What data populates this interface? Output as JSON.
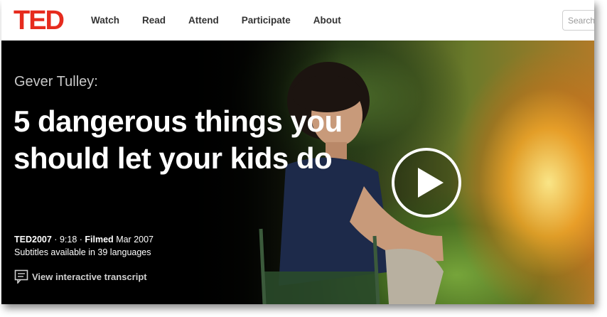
{
  "header": {
    "logo": "TED",
    "nav": [
      "Watch",
      "Read",
      "Attend",
      "Participate",
      "About"
    ],
    "search_placeholder": "Search"
  },
  "talk": {
    "speaker": "Gever Tulley:",
    "title": "5 dangerous things you should let your kids do",
    "event": "TED2007",
    "duration": "9:18",
    "filmed_label": "Filmed",
    "filmed_date": "Mar 2007",
    "subtitles": "Subtitles available in 39 languages",
    "transcript_link": "View interactive transcript"
  },
  "colors": {
    "brand_red": "#e62b1e",
    "hero_bg": "#000000"
  },
  "icons": [
    "play-icon",
    "transcript-icon"
  ]
}
